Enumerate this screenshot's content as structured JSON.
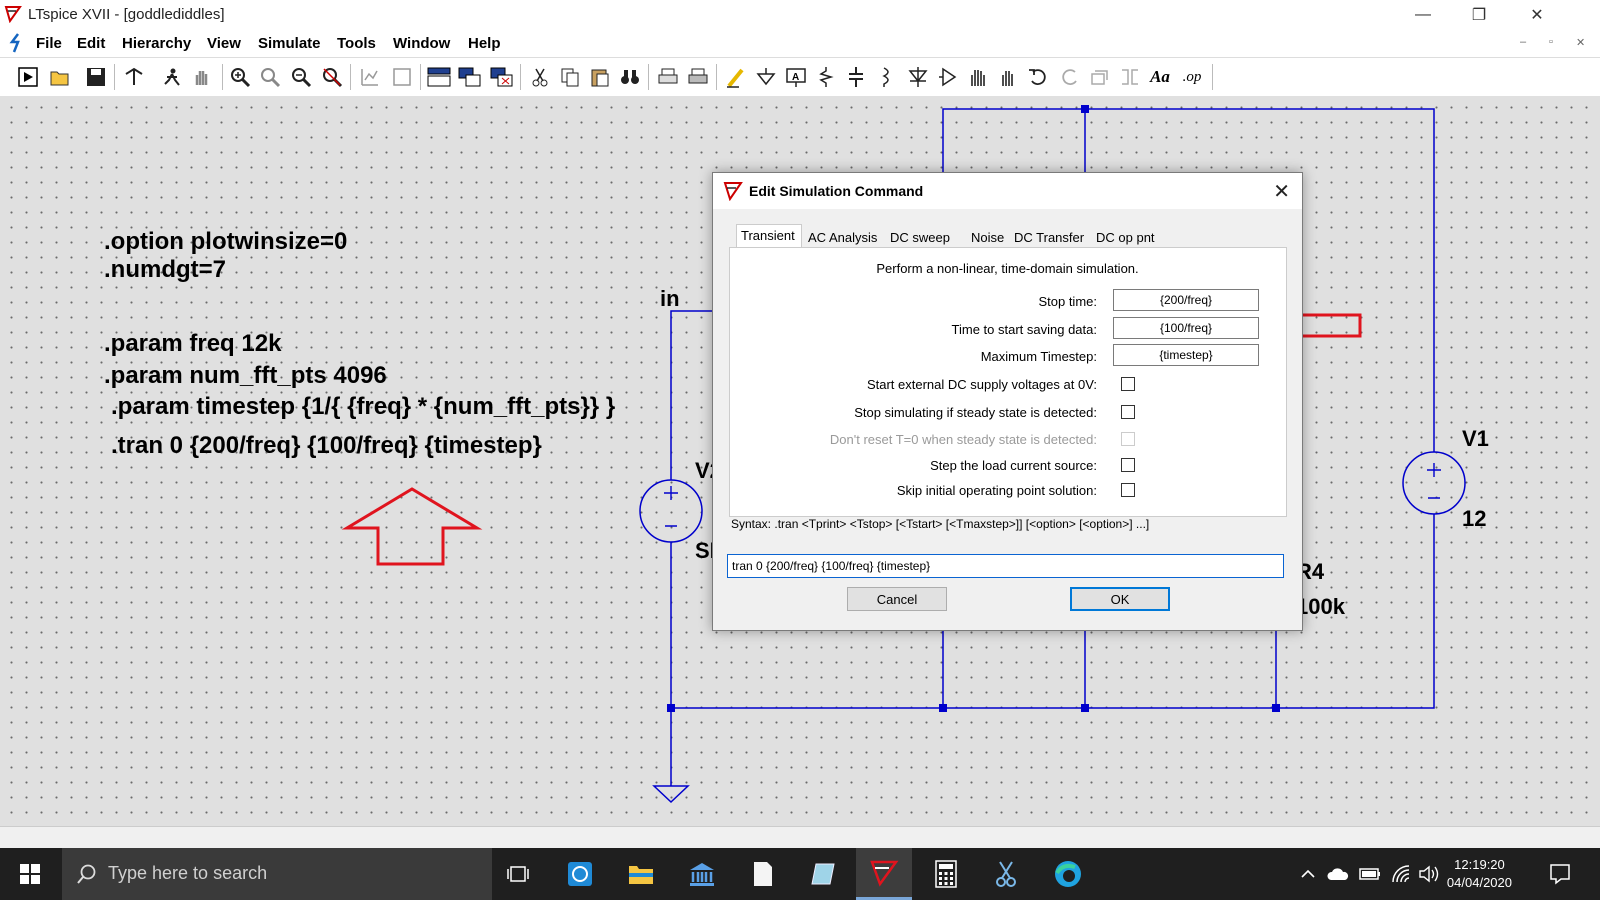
{
  "window": {
    "title": "LTspice XVII - [goddlediddles]",
    "minimize": "—",
    "maximize": "❐",
    "close": "✕"
  },
  "menu": [
    "File",
    "Edit",
    "Hierarchy",
    "View",
    "Simulate",
    "Tools",
    "Window",
    "Help"
  ],
  "mdi_controls": [
    "–",
    "▫",
    "✕"
  ],
  "toolbar_icons": [
    "run-icon",
    "open-icon",
    "save-icon",
    "control-panel-icon",
    "halt-icon",
    "pan-icon",
    "zoom-in-icon",
    "zoom-full-icon",
    "zoom-out-icon",
    "zoom-cancel-icon",
    "autorange-icon",
    "visible-traces-icon",
    "tile-icon",
    "cascade-icon",
    "close-window-icon",
    "cut-icon",
    "copy-icon",
    "paste-icon",
    "find-icon",
    "print-setup-icon",
    "print-icon",
    "wire-icon",
    "ground-icon",
    "label-net-icon",
    "resistor-icon",
    "capacitor-icon",
    "inductor-icon",
    "diode-icon",
    "component-icon",
    "move-icon",
    "drag-icon",
    "undo-icon",
    "redo-icon",
    "rotate-icon",
    "mirror-icon",
    "text-icon",
    "spice-directive-icon"
  ],
  "toolbar_text": {
    "text_icon": "Aa",
    "op_icon": ".op"
  },
  "schematic": {
    "directives": [
      ".option plotwinsize=0",
      ".numdgt=7",
      ".param freq 12k",
      ".param num_fft_pts 4096",
      ".param timestep {1/{ {freq} * {num_fft_pts}} }",
      ".tran 0 {200/freq} {100/freq} {timestep}"
    ],
    "labels": {
      "net_in": "in",
      "v2_name": "V2",
      "v2_value": "SINE",
      "v1_name": "V1",
      "v1_value": "12",
      "r4_name": "R4",
      "r4_value": "100k"
    }
  },
  "dialog": {
    "title": "Edit Simulation Command",
    "close": "✕",
    "tabs": [
      "Transient",
      "AC Analysis",
      "DC sweep",
      "Noise",
      "DC Transfer",
      "DC op pnt"
    ],
    "active_tab": "Transient",
    "description": "Perform a non-linear, time-domain simulation.",
    "fields": [
      {
        "label": "Stop time:",
        "value": "{200/freq}"
      },
      {
        "label": "Time to start saving data:",
        "value": "{100/freq}"
      },
      {
        "label": "Maximum Timestep:",
        "value": "{timestep}"
      }
    ],
    "checkboxes": [
      {
        "label": "Start external DC supply voltages at 0V:",
        "checked": false,
        "disabled": false
      },
      {
        "label": "Stop simulating if steady state is detected:",
        "checked": false,
        "disabled": false
      },
      {
        "label": "Don't reset T=0 when steady state is detected:",
        "checked": false,
        "disabled": true
      },
      {
        "label": "Step the load current source:",
        "checked": false,
        "disabled": false
      },
      {
        "label": "Skip initial operating point solution:",
        "checked": false,
        "disabled": false
      }
    ],
    "syntax": "Syntax:  .tran <Tprint> <Tstop> [<Tstart> [<Tmaxstep>]] [<option> [<option>] ...]",
    "command": "tran 0 {200/freq} {100/freq} {timestep}",
    "cancel": "Cancel",
    "ok": "OK"
  },
  "taskbar": {
    "search_placeholder": "Type here to search",
    "time": "12:19:20",
    "date": "04/04/2020"
  },
  "colors": {
    "wire": "#0000cc",
    "annotation_arrow": "#e0141e",
    "canvas_bg": "#e0e0e0",
    "accent": "#0078d7"
  }
}
